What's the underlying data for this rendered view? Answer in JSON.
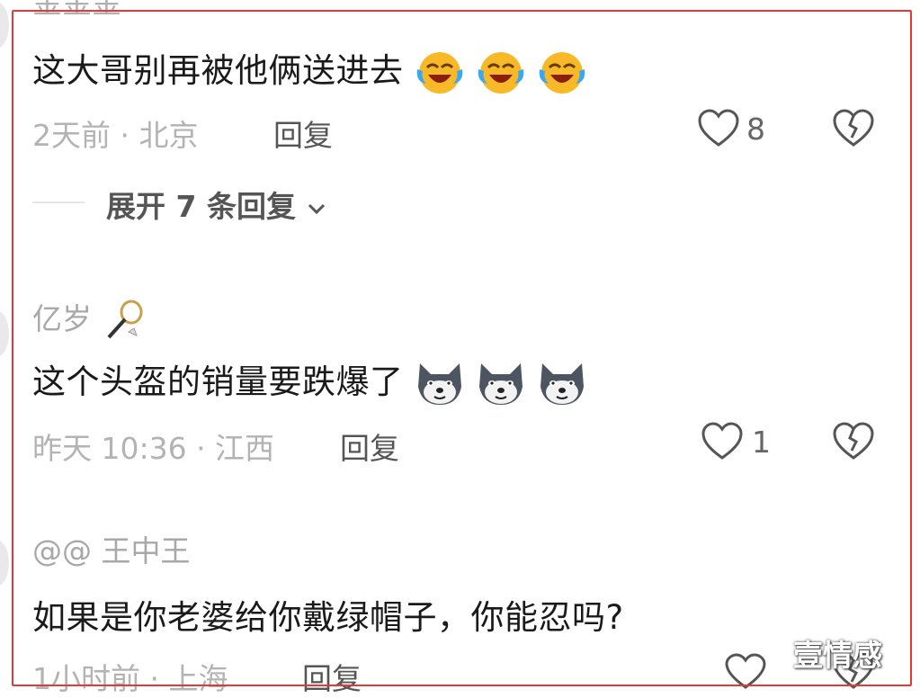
{
  "top_username_partial": "金金金",
  "comments": [
    {
      "text": "这大哥别再被他俩送进去",
      "emoji_icon": "laughing-crying-face-icon",
      "time": "2天前 · 北京",
      "reply_label": "回复",
      "likes": "8",
      "expand_label": "展开 7 条回复"
    },
    {
      "username": "亿岁",
      "badge_icon": "badminton-icon",
      "text": "这个头盔的销量要跌爆了",
      "emoji_icon": "husky-dog-icon",
      "time": "昨天 10:36 · 江西",
      "reply_label": "回复",
      "likes": "1"
    },
    {
      "username": "@@ 王中王",
      "text": "如果是你老婆给你戴绿帽子，你能忍吗?",
      "time": "1小时前 · 上海",
      "reply_label": "回复"
    }
  ],
  "watermark": "壹情感",
  "colors": {
    "frame": "#e53935",
    "muted_text": "#b3b3b3",
    "text": "#1a1a1a"
  }
}
